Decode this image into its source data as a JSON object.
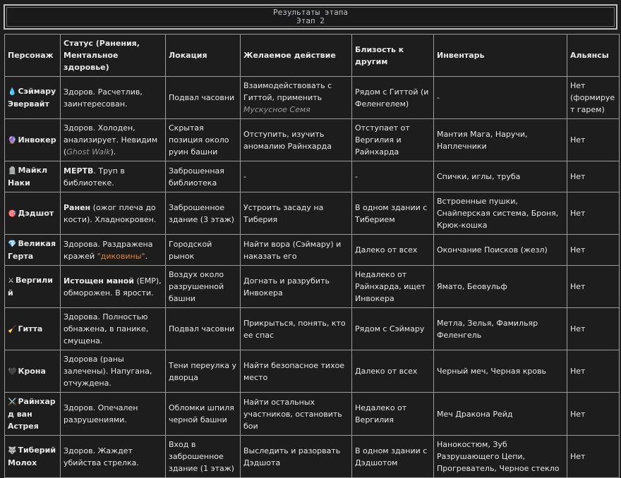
{
  "title": {
    "line1": "Результаты этапа",
    "line2": "Этап 2"
  },
  "headers": [
    "Персонаж",
    "Статус (Ранения, Ментальное здоровье)",
    "Локация",
    "Желаемое действие",
    "Близость к другим",
    "Инвентарь",
    "Альянсы"
  ],
  "rows": [
    {
      "icon": "💧",
      "icon_name": "droplet-icon",
      "name": "Сэймару Эвервайт",
      "status_pre": "",
      "status_strong": "",
      "status_post": "Здоров. Расчетлив, заинтересован.",
      "status_em": "",
      "status_end": "",
      "location": "Подвал часовни",
      "action_main": "Взаимодействовать с Гиттой, применить",
      "action_em": "Мускусное Семя",
      "proximity": "Рядом с Гиттой (и Феленгелем)",
      "inventory": "-",
      "alliance": "Нет (формирует гарем)"
    },
    {
      "icon": "🔮",
      "icon_name": "crystal-ball-icon",
      "name": "Инвокер",
      "status_pre": "",
      "status_strong": "",
      "status_post": "Здоров. Холоден, анализирует. Невидим (",
      "status_em": "Ghost Walk",
      "status_end": ").",
      "location": "Скрытая позиция около руин башни",
      "action_main": "Отступить, изучить аномалию Райнхарда",
      "action_em": "",
      "proximity": "Отступает от Вергилия и Райнхарда",
      "inventory": "Мантия Мага, Наручи, Наплечники",
      "alliance": "Нет"
    },
    {
      "icon": "🪦",
      "icon_name": "tombstone-icon",
      "name": "Майкл Наки",
      "status_pre": "",
      "status_strong": "МЕРТВ",
      "status_post": ". Труп в библиотеке.",
      "status_em": "",
      "status_end": "",
      "location": "Заброшенная библиотека",
      "action_main": "-",
      "action_em": "",
      "proximity": "-",
      "inventory": "Спички, иглы, труба",
      "alliance": "Нет"
    },
    {
      "icon": "🎯",
      "icon_name": "target-icon",
      "name": "Дэдшот",
      "status_pre": "",
      "status_strong": "Ранен",
      "status_post": " (ожог плеча до кости). Хладнокровен.",
      "status_em": "",
      "status_end": "",
      "location": "Заброшенное здание (3 этаж)",
      "action_main": "Устроить засаду на Тиберия",
      "action_em": "",
      "proximity": "В одном здании с Тиберием",
      "inventory": "Встроенные пушки, Снайперская система, Броня, Крюк-кошка",
      "alliance": "Нет"
    },
    {
      "icon": "💎",
      "icon_name": "gem-icon",
      "name": "Великая Герта",
      "status_pre": "Здорова. Раздражена кражей ",
      "status_strong": "",
      "status_post": "",
      "status_orange": "\"диковины\"",
      "status_em": "",
      "status_end": ".",
      "location": "Городской рынок",
      "action_main": "Найти вора (Сэймару) и наказать его",
      "action_em": "",
      "proximity": "Далеко от всех",
      "inventory": "Окончание Поисков (жезл)",
      "alliance": "Нет"
    },
    {
      "icon": "⚔",
      "icon_name": "katana-icon",
      "name": "Вергилий",
      "status_pre": "",
      "status_strong": "Истощен маной",
      "status_post": " (EMP), обморожен. В ярости.",
      "status_em": "",
      "status_end": "",
      "location": "Воздух около разрушенной башни",
      "action_main": "Догнать и разрубить Инвокера",
      "action_em": "",
      "proximity": "Недалеко от Райнхарда, ищет Инвокера",
      "inventory": "Ямато, Беовульф",
      "alliance": "Нет"
    },
    {
      "icon": "🧹",
      "icon_name": "broom-icon",
      "name": "Гитта",
      "status_pre": "",
      "status_strong": "",
      "status_post": "Здорова. Полностью обнажена, в панике, смущена.",
      "status_em": "",
      "status_end": "",
      "location": "Подвал часовни",
      "action_main": "Прикрыться, понять, кто ее спас",
      "action_em": "",
      "proximity": "Рядом с Сэймару",
      "inventory": "Метла, Зелья, Фамильяр Феленгель",
      "alliance": "Нет"
    },
    {
      "icon": "🖤",
      "icon_name": "black-heart-icon",
      "name": "Крона",
      "status_pre": "",
      "status_strong": "",
      "status_post": "Здорова (раны залечены). Напугана, отчуждена.",
      "status_em": "",
      "status_end": "",
      "location": "Тени переулка у дворца",
      "action_main": "Найти безопасное тихое место",
      "action_em": "",
      "proximity": "Далеко от всех",
      "inventory": "Черный меч, Черная кровь",
      "alliance": "Нет"
    },
    {
      "icon": "⚔️",
      "icon_name": "crossed-swords-icon",
      "name": "Райнхард ван Астрея",
      "status_pre": "",
      "status_strong": "",
      "status_post": "Здоров. Опечален разрушениями.",
      "status_em": "",
      "status_end": "",
      "location": "Обломки шпиля черной башни",
      "action_main": "Найти остальных участников, остановить бои",
      "action_em": "",
      "proximity": "Недалеко от Вергилия",
      "inventory": "Меч Дракона Рейд",
      "alliance": "Нет"
    },
    {
      "icon": "🐺",
      "icon_name": "wolf-icon",
      "name": "Тиберий Молох",
      "status_pre": "",
      "status_strong": "",
      "status_post": "Здоров. Жаждет убийства стрелка.",
      "status_em": "",
      "status_end": "",
      "location": "Вход в заброшенное здание (1 этаж)",
      "action_main": "Выследить и разорвать Дэдшота",
      "action_em": "",
      "proximity": "В одном здании с Дэдшотом",
      "inventory": "Нанокостюм, Зуб Разрушающего Цепи, Прогреватель, Черное стекло",
      "alliance": "Нет"
    }
  ]
}
